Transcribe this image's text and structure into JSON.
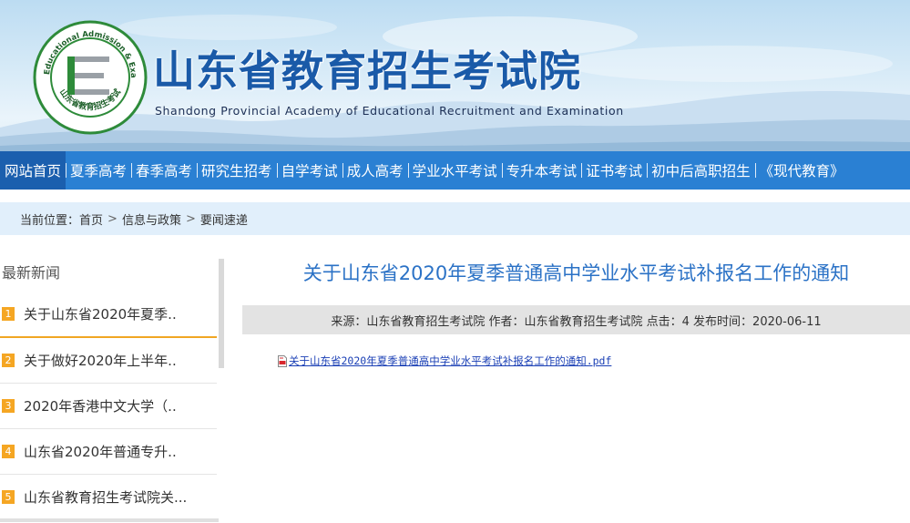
{
  "site": {
    "title": "山东省教育招生考试院",
    "subtitle": "Shandong Provincial Academy of Educational Recruitment and Examination",
    "logo": {
      "ring_text_en": "Shandong Educational Admission & Examinations",
      "ring_text_cn": "山东省教育招生考试",
      "letter": "E"
    }
  },
  "nav": {
    "items": [
      {
        "label": "网站首页",
        "active": true
      },
      {
        "label": "夏季高考"
      },
      {
        "label": "春季高考"
      },
      {
        "label": "研究生招考"
      },
      {
        "label": "自学考试"
      },
      {
        "label": "成人高考"
      },
      {
        "label": "学业水平考试"
      },
      {
        "label": "专升本考试"
      },
      {
        "label": "证书考试"
      },
      {
        "label": "初中后高职招生"
      },
      {
        "label": "《现代教育》"
      }
    ]
  },
  "breadcrumb": {
    "label": "当前位置：",
    "items": [
      "首页",
      "信息与政策",
      "要闻速递"
    ],
    "separator": ">"
  },
  "sidebar": {
    "title": "最新新闻",
    "items": [
      {
        "num": "1",
        "text": "关于山东省2020年夏季.."
      },
      {
        "num": "2",
        "text": "关于做好2020年上半年.."
      },
      {
        "num": "3",
        "text": "2020年香港中文大学（.."
      },
      {
        "num": "4",
        "text": "山东省2020年普通专升.."
      },
      {
        "num": "5",
        "text": "山东省教育招生考试院关..."
      }
    ]
  },
  "article": {
    "title": "关于山东省2020年夏季普通高中学业水平考试补报名工作的通知",
    "meta": "来源：山东省教育招生考试院 作者：山东省教育招生考试院 点击：4 发布时间：2020-06-11",
    "attachment": {
      "label": "关于山东省2020年夏季普通高中学业水平考试补报名工作的通知.pdf",
      "icon": "pdf-file-icon"
    }
  },
  "colors": {
    "nav_bg": "#2a80d3",
    "nav_active": "#1b5fae",
    "title_blue": "#1a5aa8",
    "article_title": "#2b72c6",
    "badge_orange": "#f5a623",
    "logo_green": "#2e8b3a"
  }
}
